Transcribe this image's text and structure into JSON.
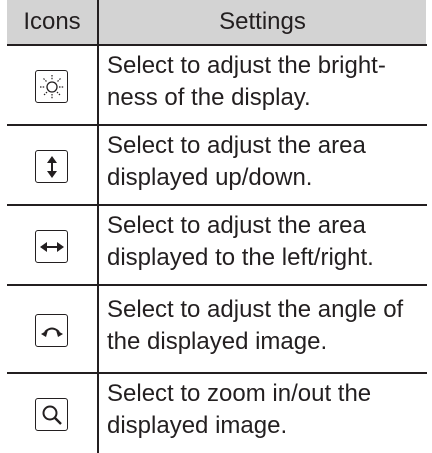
{
  "header": {
    "col_icons": "Icons",
    "col_settings": "Settings"
  },
  "rows": [
    {
      "icon": "brightness-icon",
      "line1": "Select to adjust the bright-",
      "line2": "ness of the display."
    },
    {
      "icon": "up-down-arrow-icon",
      "line1": "Select to adjust the area",
      "line2": "displayed up/down."
    },
    {
      "icon": "left-right-arrow-icon",
      "line1": "Select to adjust the area",
      "line2": "displayed to the left/right."
    },
    {
      "icon": "angle-adjust-icon",
      "line1": "Select to adjust the angle of",
      "line2": "the displayed image."
    },
    {
      "icon": "zoom-icon",
      "line1": "Select to zoom in/out the",
      "line2": "displayed image."
    }
  ]
}
